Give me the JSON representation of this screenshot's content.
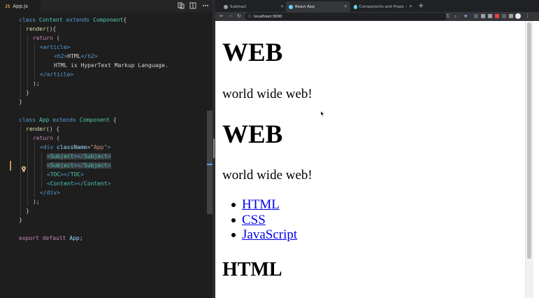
{
  "editor": {
    "tab_label": "App.js",
    "tab_icon": "JS",
    "actions": [
      "compare-changes-icon",
      "split-editor-icon",
      "more-actions-icon"
    ],
    "lines": [
      {
        "tokens": [
          [
            "kw",
            "class"
          ],
          [
            "pun",
            " "
          ],
          [
            "cls",
            "Content"
          ],
          [
            "pun",
            " "
          ],
          [
            "kw",
            "extends"
          ],
          [
            "pun",
            " "
          ],
          [
            "cls",
            "Component"
          ],
          [
            "pun",
            "{"
          ]
        ]
      },
      {
        "tokens": [
          [
            "fn",
            "render"
          ],
          [
            "pun",
            "(){"
          ]
        ]
      },
      {
        "tokens": [
          [
            "kw2",
            "return"
          ],
          [
            "pun",
            " ("
          ]
        ]
      },
      {
        "tokens": [
          [
            "tag",
            "<"
          ],
          [
            "tag",
            "article"
          ],
          [
            "tag",
            ">"
          ]
        ]
      },
      {
        "tokens": [
          [
            "tag",
            "<"
          ],
          [
            "tag",
            "h2"
          ],
          [
            "tag",
            ">"
          ],
          [
            "txt",
            "HTML"
          ],
          [
            "tag",
            "</"
          ],
          [
            "tag",
            "h2"
          ],
          [
            "tag",
            ">"
          ]
        ]
      },
      {
        "tokens": [
          [
            "txt",
            "HTML is HyperText Markup Language."
          ]
        ]
      },
      {
        "tokens": [
          [
            "tag",
            "</"
          ],
          [
            "tag",
            "article"
          ],
          [
            "tag",
            ">"
          ]
        ]
      },
      {
        "tokens": [
          [
            "pun",
            ");"
          ]
        ]
      },
      {
        "tokens": [
          [
            "pun",
            "}"
          ]
        ]
      },
      {
        "tokens": [
          [
            "pun",
            "}"
          ]
        ]
      },
      {
        "tokens": []
      },
      {
        "tokens": [
          [
            "kw",
            "class"
          ],
          [
            "pun",
            " "
          ],
          [
            "cls",
            "App"
          ],
          [
            "pun",
            " "
          ],
          [
            "kw",
            "extends"
          ],
          [
            "pun",
            " "
          ],
          [
            "cls",
            "Component"
          ],
          [
            "pun",
            " {"
          ]
        ]
      },
      {
        "tokens": [
          [
            "fn",
            "render"
          ],
          [
            "pun",
            "() {"
          ]
        ]
      },
      {
        "tokens": [
          [
            "kw2",
            "return"
          ],
          [
            "pun",
            " ("
          ]
        ]
      },
      {
        "tokens": [
          [
            "tag",
            "<"
          ],
          [
            "tag",
            "div"
          ],
          [
            "pun",
            " "
          ],
          [
            "attr",
            "className"
          ],
          [
            "pun",
            "="
          ],
          [
            "str",
            "\"App\""
          ],
          [
            "tag",
            ">"
          ]
        ]
      },
      {
        "tokens": [
          [
            "tag",
            "<"
          ],
          [
            "tagname",
            "Subject"
          ],
          [
            "tag",
            "></"
          ],
          [
            "tagname",
            "Subject"
          ],
          [
            "tag",
            ">"
          ]
        ],
        "highlight": true
      },
      {
        "tokens": [
          [
            "tag",
            "<"
          ],
          [
            "tagname",
            "Subject"
          ],
          [
            "tag",
            "></"
          ],
          [
            "tagname",
            "Subject"
          ],
          [
            "tag",
            ">"
          ]
        ],
        "highlight": true
      },
      {
        "tokens": [
          [
            "tag",
            "<"
          ],
          [
            "tagname",
            "TOC"
          ],
          [
            "tag",
            "></"
          ],
          [
            "tagname",
            "TOC"
          ],
          [
            "tag",
            ">"
          ]
        ]
      },
      {
        "tokens": [
          [
            "tag",
            "<"
          ],
          [
            "tagname",
            "Content"
          ],
          [
            "tag",
            "></"
          ],
          [
            "tagname",
            "Content"
          ],
          [
            "tag",
            ">"
          ]
        ]
      },
      {
        "tokens": [
          [
            "tag",
            "</"
          ],
          [
            "tag",
            "div"
          ],
          [
            "tag",
            ">"
          ]
        ]
      },
      {
        "tokens": [
          [
            "pun",
            ");"
          ]
        ]
      },
      {
        "tokens": [
          [
            "pun",
            "}"
          ]
        ]
      },
      {
        "tokens": [
          [
            "pun",
            "}"
          ]
        ]
      },
      {
        "tokens": []
      },
      {
        "tokens": [
          [
            "kw2",
            "export"
          ],
          [
            "pun",
            " "
          ],
          [
            "kw2",
            "default"
          ],
          [
            "pun",
            " "
          ],
          [
            "attr",
            "App"
          ],
          [
            "pun",
            ";"
          ]
        ]
      }
    ]
  },
  "browser": {
    "tabs": [
      {
        "title": "Subtract",
        "active": false,
        "favicon_color": "#9aa0a6"
      },
      {
        "title": "React App",
        "active": true,
        "favicon_color": "#61dafb"
      },
      {
        "title": "Components and Props – React",
        "active": false,
        "favicon_color": "#61dafb"
      }
    ],
    "url": "localhost:3000",
    "extension_colors": [
      "#8ab4f8",
      "#9aa0a6",
      "#9aa0a6",
      "#ea4335",
      "#34a853",
      "#9aa0a6"
    ]
  },
  "page": {
    "heading1": "WEB",
    "subtitle1": "world wide web!",
    "heading2": "WEB",
    "subtitle2": "world wide web!",
    "toc": [
      "HTML",
      "CSS",
      "JavaScript"
    ],
    "article_title": "HTML"
  }
}
